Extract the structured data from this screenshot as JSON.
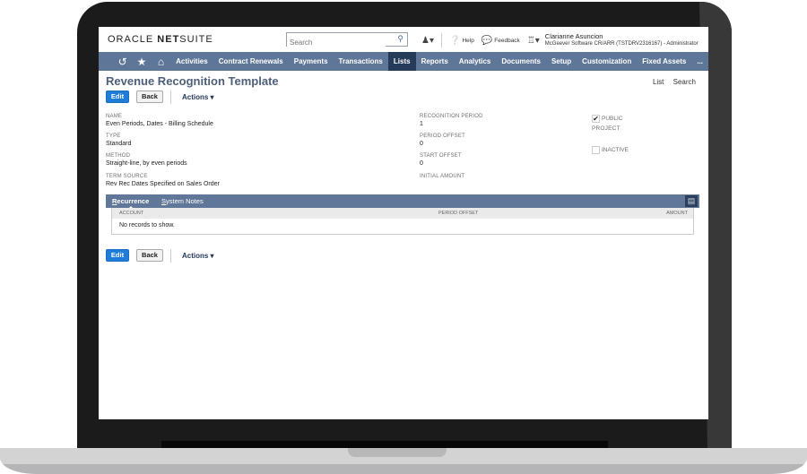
{
  "header": {
    "logo_oracle": "ORACLE ",
    "logo_netsuite_bold": "NET",
    "logo_netsuite_rest": "SUITE",
    "search_placeholder": "Search",
    "help_label": "Help",
    "feedback_label": "Feedback",
    "user_name": "Clarianne Asuncion",
    "user_account": "McGeever Software CR/ARR (TSTDRV2316167) - Administrator"
  },
  "nav": {
    "items": [
      {
        "label": "Activities",
        "active": false
      },
      {
        "label": "Contract Renewals",
        "active": false
      },
      {
        "label": "Payments",
        "active": false
      },
      {
        "label": "Transactions",
        "active": false
      },
      {
        "label": "Lists",
        "active": true
      },
      {
        "label": "Reports",
        "active": false
      },
      {
        "label": "Analytics",
        "active": false
      },
      {
        "label": "Documents",
        "active": false
      },
      {
        "label": "Setup",
        "active": false
      },
      {
        "label": "Customization",
        "active": false
      },
      {
        "label": "Fixed Assets",
        "active": false
      },
      {
        "label": "...",
        "active": false
      }
    ]
  },
  "page": {
    "title": "Revenue Recognition Template",
    "list_link": "List",
    "search_link": "Search",
    "edit_label": "Edit",
    "back_label": "Back",
    "actions_label": "Actions ▾"
  },
  "fields": {
    "name_label": "NAME",
    "name_value": "Even Periods, Dates - Billing Schedule",
    "type_label": "TYPE",
    "type_value": "Standard",
    "method_label": "METHOD",
    "method_value": "Straight-line, by even periods",
    "term_source_label": "TERM SOURCE",
    "term_source_value": "Rev Rec Dates Specified on Sales Order",
    "recognition_period_label": "RECOGNITION PERIOD",
    "recognition_period_value": "1",
    "period_offset_label": "PERIOD OFFSET",
    "period_offset_value": "0",
    "start_offset_label": "START OFFSET",
    "start_offset_value": "0",
    "initial_amount_label": "INITIAL AMOUNT",
    "public_label": "PUBLIC",
    "public_checked": "✔",
    "project_label": "PROJECT",
    "inactive_label": "INACTIVE"
  },
  "subtabs": {
    "recurrence_first": "R",
    "recurrence_rest": "ecurrence",
    "system_notes_first": "S",
    "system_notes_rest": "ystem Notes"
  },
  "grid": {
    "columns": [
      "ACCOUNT",
      "PERIOD OFFSET",
      "AMOUNT"
    ],
    "empty_message": "No records to show."
  }
}
